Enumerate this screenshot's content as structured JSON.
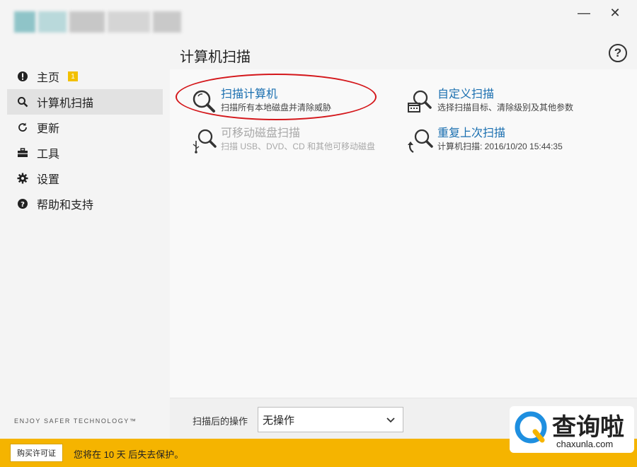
{
  "window": {
    "minimize_symbol": "—",
    "close_symbol": "✕"
  },
  "logo": {
    "colors": [
      "#8fc4c8",
      "#b9d9db",
      "#9ea5a8",
      "#c7c7c7",
      "#d5d5d5"
    ]
  },
  "sidebar": {
    "items": [
      {
        "label": "主页",
        "icon": "alert-circle-icon",
        "badge": "1",
        "active": false
      },
      {
        "label": "计算机扫描",
        "icon": "search-icon",
        "active": true
      },
      {
        "label": "更新",
        "icon": "refresh-icon",
        "active": false
      },
      {
        "label": "工具",
        "icon": "toolbox-icon",
        "active": false
      },
      {
        "label": "设置",
        "icon": "gear-icon",
        "active": false
      },
      {
        "label": "帮助和支持",
        "icon": "help-circle-icon",
        "active": false
      }
    ],
    "tagline": "ENJOY SAFER TECHNOLOGY™"
  },
  "main": {
    "title": "计算机扫描",
    "help_symbol": "?",
    "options": [
      {
        "title": "扫描计算机",
        "desc": "扫描所有本地磁盘并清除威胁",
        "icon": "magnifier-icon",
        "enabled": true
      },
      {
        "title": "自定义扫描",
        "desc": "选择扫描目标、清除级别及其他参数",
        "icon": "custom-scan-icon",
        "enabled": true
      },
      {
        "title": "可移动磁盘扫描",
        "desc": "扫描 USB、DVD、CD 和其他可移动磁盘",
        "icon": "usb-scan-icon",
        "enabled": false
      },
      {
        "title": "重复上次扫描",
        "desc": "计算机扫描: 2016/10/20 15:44:35",
        "icon": "repeat-scan-icon",
        "enabled": true
      }
    ]
  },
  "action_bar": {
    "label": "扫描后的操作",
    "selected": "无操作"
  },
  "footer": {
    "buy_label": "购买许可证",
    "message": "您将在 10 天 后失去保护。"
  },
  "watermark": {
    "brand_cn": "查询啦",
    "brand_en": "chaxunla.com"
  },
  "colors": {
    "accent_link": "#1a6fb0",
    "footer_bg": "#f5b400",
    "highlight_ring": "#d4171b",
    "badge": "#f2c000"
  }
}
